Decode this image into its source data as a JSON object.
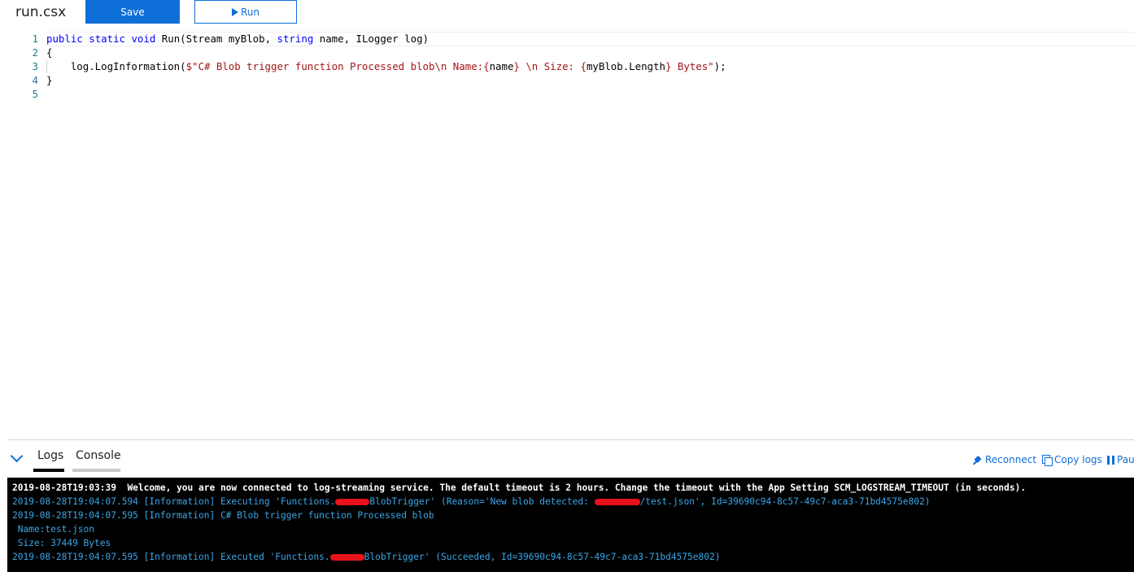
{
  "toolbar": {
    "file_name": "run.csx",
    "save_label": "Save",
    "run_label": "Run"
  },
  "editor": {
    "lines": [
      {
        "num": "1"
      },
      {
        "num": "2"
      },
      {
        "num": "3"
      },
      {
        "num": "4"
      },
      {
        "num": "5"
      }
    ],
    "code": {
      "l1_kw1": "public",
      "l1_kw2": "static",
      "l1_kw3": "void",
      "l1_rest1": " Run(Stream myBlob, ",
      "l1_kw4": "string",
      "l1_rest2": " name, ILogger log)",
      "l2": "{",
      "l3_pre": "    log.LogInformation(",
      "l3_str1": "$\"C# Blob trigger function Processed blob\\n Name:{",
      "l3_var1": "name",
      "l3_str2": "} \\n Size: {",
      "l3_var2": "myBlob.Length",
      "l3_str3": "} Bytes\"",
      "l3_post": ");",
      "l4": "}"
    }
  },
  "panel": {
    "tabs": [
      {
        "label": "Logs",
        "active": true
      },
      {
        "label": "Console",
        "active": false
      }
    ],
    "actions": {
      "reconnect": "Reconnect",
      "copy_logs": "Copy logs",
      "pause": "Pau"
    }
  },
  "logs": {
    "line1": "2019-08-28T19:03:39  Welcome, you are now connected to log-streaming service. The default timeout is 2 hours. Change the timeout with the App Setting SCM_LOGSTREAM_TIMEOUT (in seconds).",
    "line2_a": "2019-08-28T19:04:07.594 [Information] Executing 'Functions.",
    "line2_b": "BlobTrigger' (Reason='New blob detected: ",
    "line2_c": "/test.json', Id=39690c94-8c57-49c7-aca3-71bd4575e802)",
    "line3": "2019-08-28T19:04:07.595 [Information] C# Blob trigger function Processed blob",
    "line4": " Name:test.json",
    "line5": " Size: 37449 Bytes",
    "line6_a": "2019-08-28T19:04:07.595 [Information] Executed 'Functions.",
    "line6_b": "BlobTrigger' (Succeeded, Id=39690c94-8c57-49c7-aca3-71bd4575e802)"
  },
  "colors": {
    "accent": "#0f6fd8",
    "keyword": "#0000ff",
    "string": "#a31515",
    "line_number": "#237893",
    "log_info": "#3aa6e8",
    "redaction": "#e8121b"
  }
}
